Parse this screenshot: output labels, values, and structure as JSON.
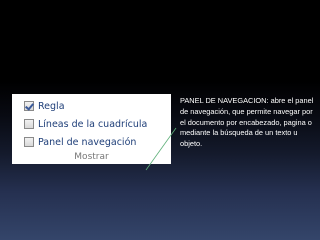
{
  "options_panel": {
    "checkboxes": [
      {
        "label": "Regla",
        "checked": true
      },
      {
        "label": "Líneas de la cuadrícula",
        "checked": false
      },
      {
        "label": "Panel de navegación",
        "checked": false
      }
    ],
    "group_label": "Mostrar"
  },
  "callout": {
    "text": "PANEL DE NAVEGACION: abre el panel de navegación, que permite navegar por el documento por encabezado, pagina o mediante la búsqueda de un texto u objeto."
  },
  "colors": {
    "label_text": "#1e3e78",
    "group_label_text": "#777777",
    "connector_line": "#5fb07a",
    "callout_text": "#ffffff"
  }
}
